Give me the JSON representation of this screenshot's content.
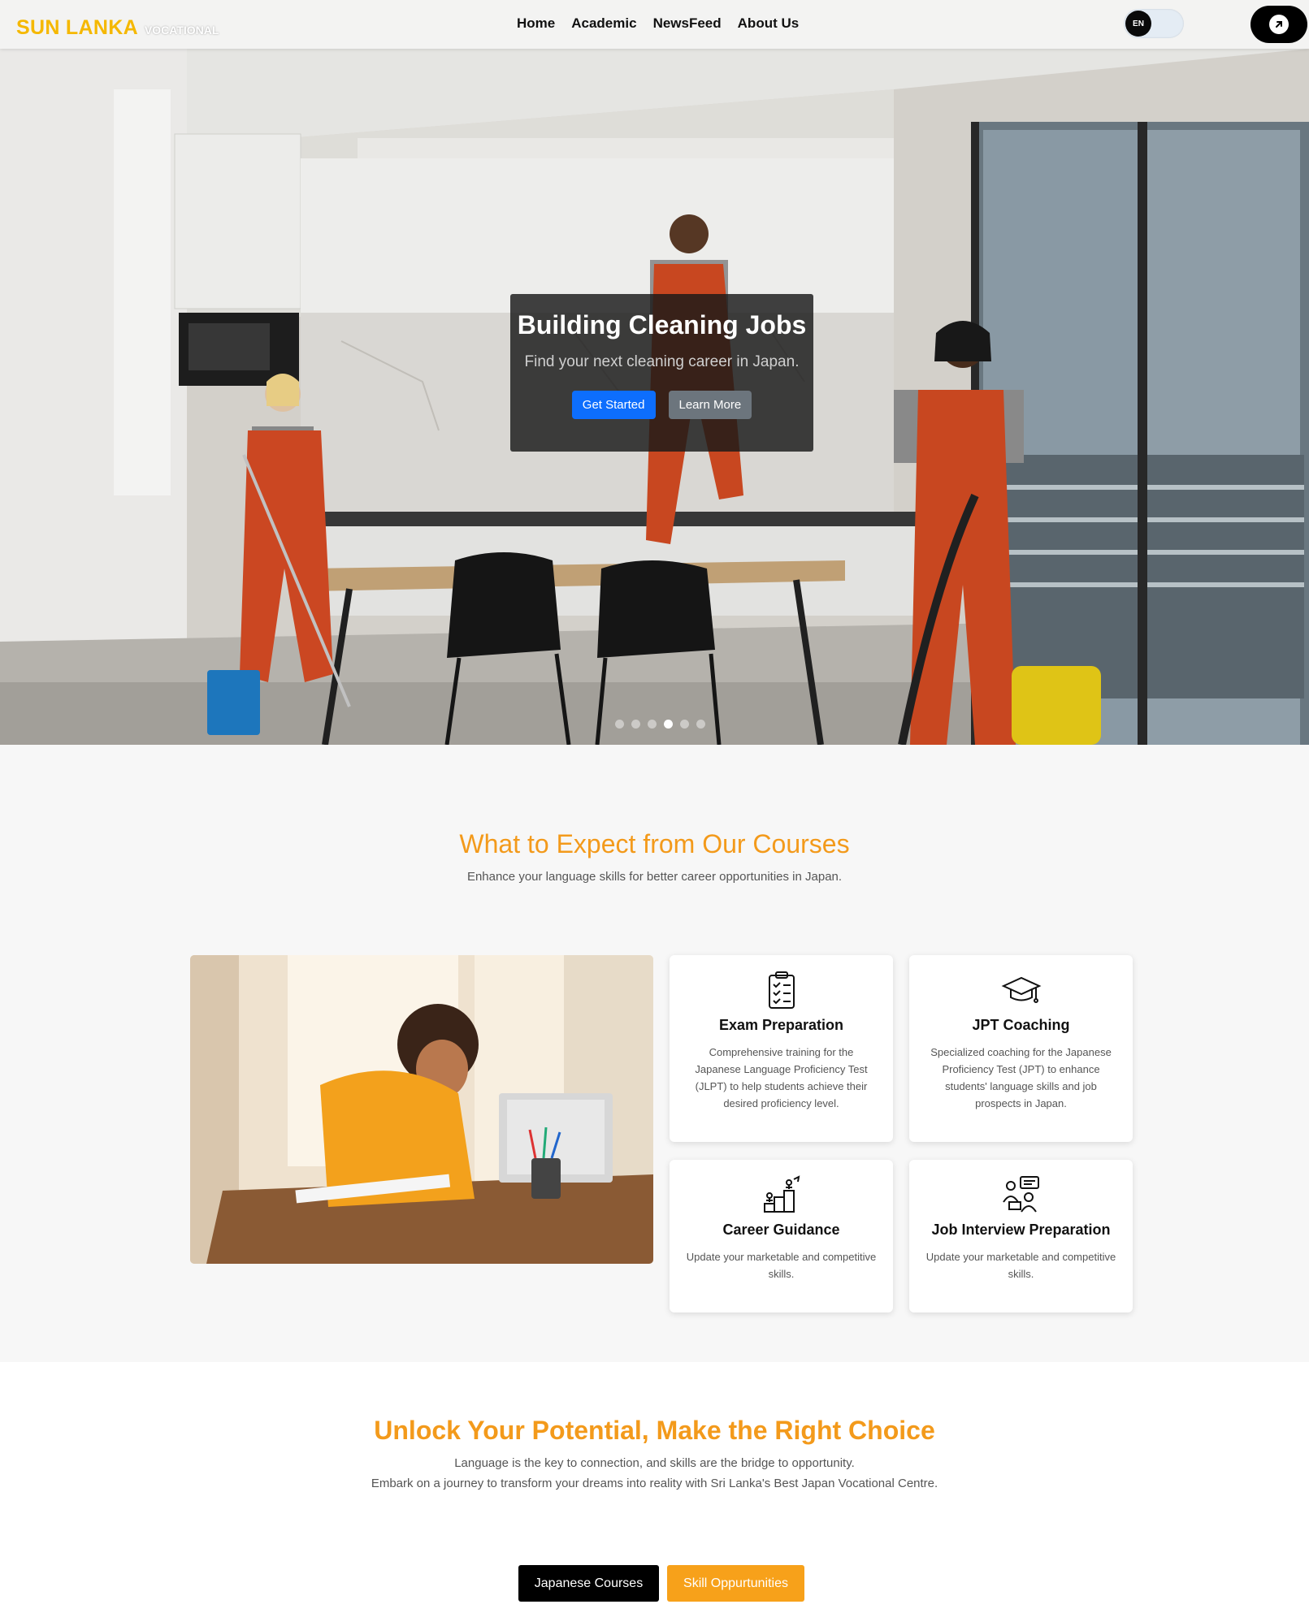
{
  "brand": {
    "name": "SUN LANKA",
    "tagline": "VOCATIONAL"
  },
  "nav": {
    "items": [
      "Home",
      "Academic",
      "NewsFeed",
      "About Us"
    ]
  },
  "lang_toggle": {
    "label": "EN"
  },
  "header_cta_icon": "arrow-up-right-icon",
  "hero": {
    "title": "Building Cleaning Jobs",
    "subtitle": "Find your next cleaning career in Japan.",
    "primary_button": "Get Started",
    "secondary_button": "Learn More",
    "slide_count": 6,
    "active_slide": 4
  },
  "courses": {
    "title": "What to Expect from Our Courses",
    "subtitle": "Enhance your language skills for better career opportunities in Japan.",
    "cards": [
      {
        "icon": "clipboard-checklist-icon",
        "title": "Exam Preparation",
        "text": "Comprehensive training for the Japanese Language Proficiency Test (JLPT) to help students achieve their desired proficiency level."
      },
      {
        "icon": "graduation-cap-icon",
        "title": "JPT Coaching",
        "text": "Specialized coaching for the Japanese Proficiency Test (JPT) to enhance students' language skills and job prospects in Japan."
      },
      {
        "icon": "career-ladder-icon",
        "title": "Career Guidance",
        "text": "Update your marketable and competitive skills."
      },
      {
        "icon": "interview-icon",
        "title": "Job Interview Preparation",
        "text": "Update your marketable and competitive skills."
      }
    ]
  },
  "potential": {
    "title": "Unlock Your Potential, Make the Right Choice",
    "line1": "Language is the key to connection, and skills are the bridge to opportunity.",
    "line2": "Embark on a journey to transform your dreams into reality with Sri Lanka's Best Japan Vocational Centre.",
    "button_dark": "Japanese Courses",
    "button_orange": "Skill Oppurtunities"
  },
  "colors": {
    "accent_orange": "#f39a1b",
    "brand_yellow": "#f5b800",
    "primary_blue": "#0d6efd"
  }
}
